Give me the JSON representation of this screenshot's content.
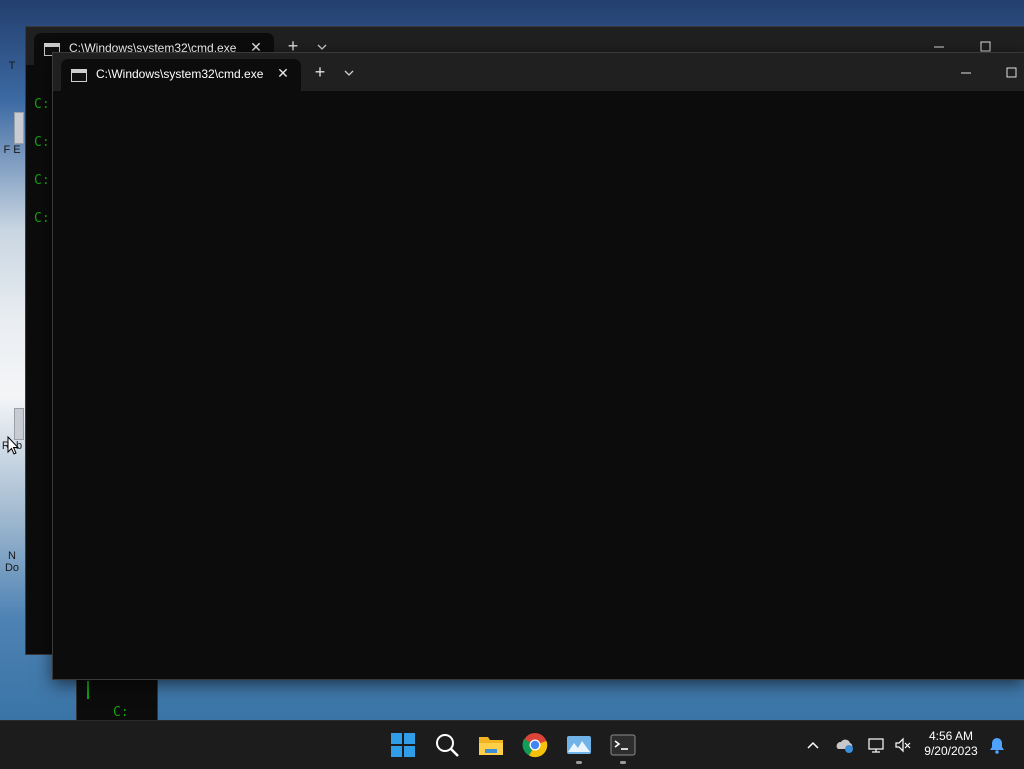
{
  "desktop": {
    "icons": [
      {
        "label": "T"
      },
      {
        "label": "F E"
      },
      {
        "label": "Rob"
      },
      {
        "label": "N Do"
      }
    ]
  },
  "back_window": {
    "tab_title": "C:\\Windows\\system32\\cmd.exe",
    "prompts": [
      "C:",
      "C:",
      "C:",
      "C:"
    ]
  },
  "front_window": {
    "tab_title": "C:\\Windows\\system32\\cmd.exe",
    "new_tab": "+"
  },
  "behind_terminal": {
    "prompt": "C:"
  },
  "taskbar": {
    "apps": [
      "start-icon",
      "search-icon",
      "file-explorer-icon",
      "chrome-icon",
      "photos-icon",
      "terminal-icon"
    ]
  },
  "clock": {
    "time": "4:56 AM",
    "date": "9/20/2023"
  },
  "colors": {
    "terminal_bg": "#0c0c0c",
    "titlebar_bg": "#202020",
    "prompt_green": "#13a10e",
    "taskbar_bg": "#1c1c1c"
  }
}
